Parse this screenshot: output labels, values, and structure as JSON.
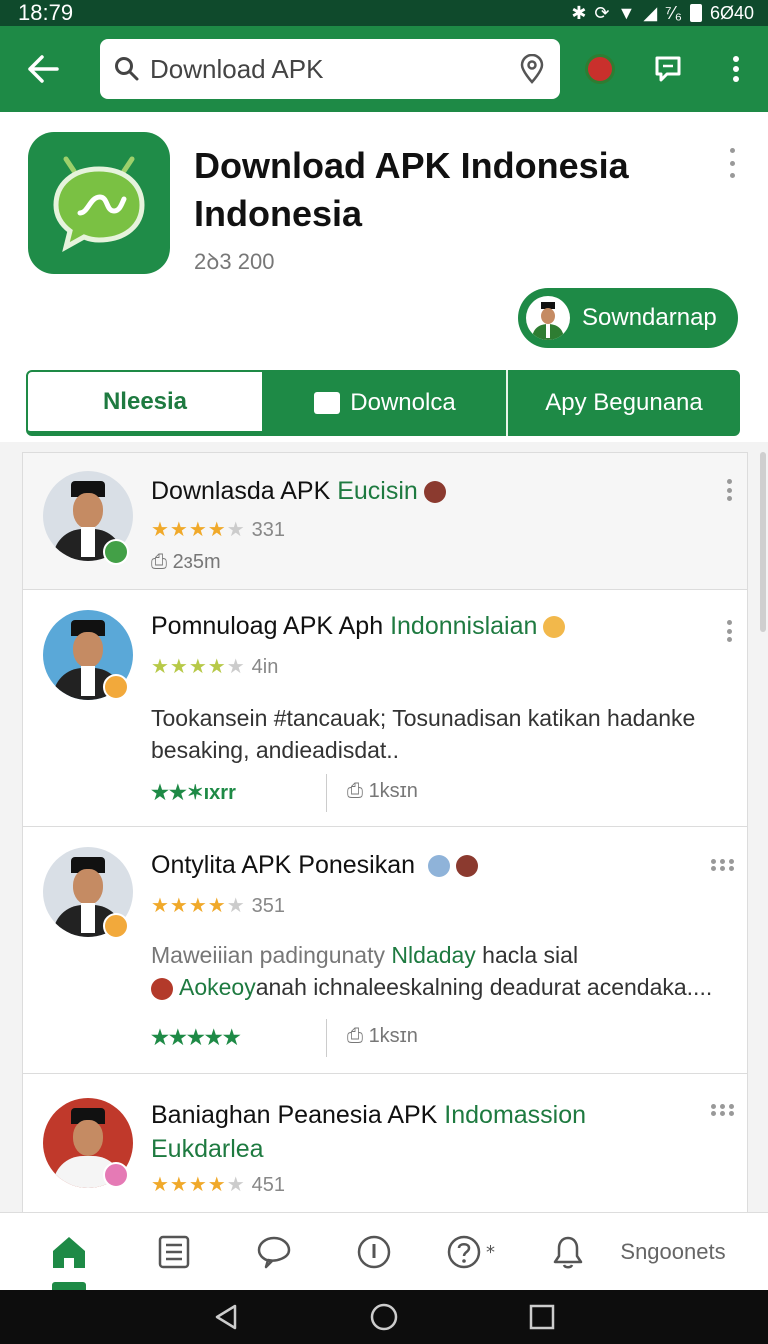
{
  "status_bar": {
    "time": "18:79",
    "right_text": "⁷⁄₆",
    "battery_text": "6Ø40"
  },
  "search": {
    "value": "Download APK"
  },
  "app": {
    "title": "Download APK Indonesia Indonesia",
    "subtitle": "2ꝺ3 200",
    "action_label": "Sowndarnap"
  },
  "tabs": [
    {
      "label": "Nleesia"
    },
    {
      "label": "Downolca"
    },
    {
      "label": "Apy Begunana"
    }
  ],
  "items": [
    {
      "title": "Downlasda APK ",
      "title_hl": "Eucisin",
      "rating": 4,
      "rating_text": "331",
      "meta": "2ɜ5m"
    },
    {
      "title": "Pomnuloag APK Aph ",
      "title_hl": "Indonnislaian",
      "rating": 4,
      "rating_text": "4in",
      "desc": "Tookansein #tancauak; Tosunadisan katikan hadanke besaking, andieadisdat..",
      "footer_stars": "★★✶ıxrr",
      "downloads": "1ksɪn"
    },
    {
      "title": "Ontylita APK Ponesikan ",
      "rating": 4,
      "rating_text": "351",
      "desc_muted": "Maweiiian padingunaty ",
      "desc_hl1": "Nldaday",
      "desc_mid": " hacla sial",
      "desc_hl2": "Aokeoy",
      "desc_end": "anah ichnaleeskalning deadurat acendaka....",
      "footer_stars": "★★★★★",
      "downloads": "1ksɪn"
    },
    {
      "title": "Baniaghan Peanesia APK ",
      "title_hl": "Indomassion",
      "title_line2": "Eukdarlea",
      "rating": 4,
      "rating_text": "451"
    }
  ],
  "bottom_nav": {
    "last_label": "Sngoonets"
  },
  "colors": {
    "primary": "#1e8a46",
    "status": "#0f4a2c",
    "star": "#f0a92a"
  }
}
